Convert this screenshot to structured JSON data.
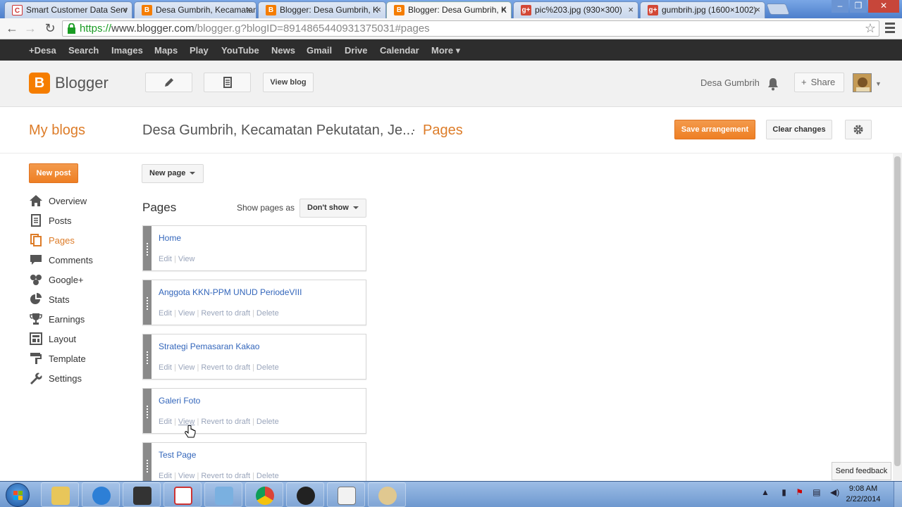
{
  "browser": {
    "tabs": [
      {
        "label": "Smart Customer Data Serv",
        "favicon": "custom"
      },
      {
        "label": "Desa Gumbrih, Kecamatan",
        "favicon": "blogger"
      },
      {
        "label": "Blogger: Desa Gumbrih, K",
        "favicon": "blogger"
      },
      {
        "label": "Blogger: Desa Gumbrih, K",
        "favicon": "blogger",
        "active": true
      },
      {
        "label": "pic%203.jpg (930×300)",
        "favicon": "gplus"
      },
      {
        "label": "gumbrih.jpg (1600×1002)",
        "favicon": "gplus"
      }
    ],
    "url_scheme": "https://",
    "url_host": "www.blogger.com",
    "url_path": "/blogger.g?blogID=8914865440931375031#pages"
  },
  "gbar": {
    "items": [
      "+Desa",
      "Search",
      "Images",
      "Maps",
      "Play",
      "YouTube",
      "News",
      "Gmail",
      "Drive",
      "Calendar",
      "More ▾"
    ]
  },
  "header": {
    "logo_letter": "B",
    "logo_text": "Blogger",
    "view_blog": "View blog",
    "username": "Desa Gumbrih",
    "share": "Share"
  },
  "subheader": {
    "my_blogs": "My blogs",
    "blog_title": "Desa Gumbrih, Kecamatan Pekutatan, Je...",
    "separator": "·",
    "page_name": "Pages",
    "save_arrangement": "Save arrangement",
    "clear_changes": "Clear changes"
  },
  "sidebar": {
    "new_post": "New post",
    "items": [
      {
        "label": "Overview",
        "icon": "home-icon"
      },
      {
        "label": "Posts",
        "icon": "posts-icon"
      },
      {
        "label": "Pages",
        "icon": "pages-icon",
        "active": true
      },
      {
        "label": "Comments",
        "icon": "comments-icon"
      },
      {
        "label": "Google+",
        "icon": "google-plus-icon"
      },
      {
        "label": "Stats",
        "icon": "stats-icon"
      },
      {
        "label": "Earnings",
        "icon": "trophy-icon"
      },
      {
        "label": "Layout",
        "icon": "layout-icon"
      },
      {
        "label": "Template",
        "icon": "template-icon"
      },
      {
        "label": "Settings",
        "icon": "wrench-icon"
      }
    ]
  },
  "main": {
    "new_page": "New page",
    "heading": "Pages",
    "show_pages_as": "Show pages as",
    "show_option": "Don't show",
    "pages": [
      {
        "title": "Home",
        "actions": [
          "Edit",
          "View"
        ]
      },
      {
        "title": "Anggota KKN-PPM UNUD PeriodeVIII",
        "actions": [
          "Edit",
          "View",
          "Revert to draft",
          "Delete"
        ]
      },
      {
        "title": "Strategi Pemasaran Kakao",
        "actions": [
          "Edit",
          "View",
          "Revert to draft",
          "Delete"
        ]
      },
      {
        "title": "Galeri Foto",
        "actions": [
          "Edit",
          "View",
          "Revert to draft",
          "Delete"
        ]
      },
      {
        "title": "Test Page",
        "actions": [
          "Edit",
          "View",
          "Revert to draft",
          "Delete"
        ]
      }
    ]
  },
  "feedback": "Send feedback",
  "taskbar": {
    "time": "9:08 AM",
    "date": "2/22/2014"
  },
  "colors": {
    "accent_orange": "#dd7c28",
    "button_orange": "#f28c38",
    "link_blue": "#3366bb",
    "gbar_bg": "#2d2d2d"
  }
}
